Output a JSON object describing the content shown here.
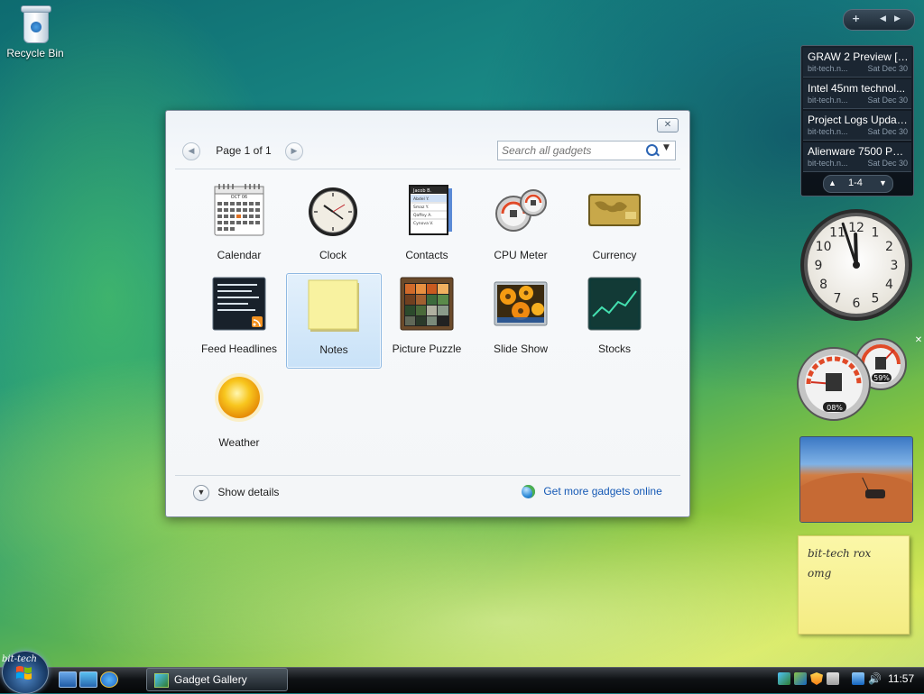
{
  "desktop": {
    "recycle_bin_label": "Recycle Bin"
  },
  "gallery": {
    "page_label": "Page 1 of 1",
    "search_placeholder": "Search all gadgets",
    "gadgets": [
      {
        "name": "Calendar",
        "icon": "calendar-icon"
      },
      {
        "name": "Clock",
        "icon": "clock-icon"
      },
      {
        "name": "Contacts",
        "icon": "contacts-icon"
      },
      {
        "name": "CPU Meter",
        "icon": "cpu-meter-icon"
      },
      {
        "name": "Currency",
        "icon": "currency-icon"
      },
      {
        "name": "Feed Headlines",
        "icon": "feed-headlines-icon"
      },
      {
        "name": "Notes",
        "icon": "notes-icon",
        "selected": true
      },
      {
        "name": "Picture Puzzle",
        "icon": "picture-puzzle-icon"
      },
      {
        "name": "Slide Show",
        "icon": "slide-show-icon"
      },
      {
        "name": "Stocks",
        "icon": "stocks-icon"
      },
      {
        "name": "Weather",
        "icon": "weather-icon"
      }
    ],
    "calendar_thumb_month": "OCT 06",
    "contacts_thumb": {
      "title": "Jacob B.",
      "names": [
        "Abdel Y.",
        "Smaz Y.",
        "Qaffey A.",
        "Cynova V."
      ]
    },
    "show_details_label": "Show details",
    "get_more_label": "Get more gadgets online"
  },
  "sidebar": {
    "feed": {
      "items": [
        {
          "title": "GRAW 2 Preview [G...",
          "source": "bit-tech.n...",
          "date": "Sat Dec 30"
        },
        {
          "title": "Intel 45nm technol...",
          "source": "bit-tech.n...",
          "date": "Sat Dec 30"
        },
        {
          "title": "Project Logs Updat...",
          "source": "bit-tech.n...",
          "date": "Sat Dec 30"
        },
        {
          "title": "Alienware 7500 P2 ...",
          "source": "bit-tech.n...",
          "date": "Sat Dec 30"
        }
      ],
      "range": "1-4"
    },
    "clock": {
      "hour": 11,
      "minute": 57,
      "numerals": [
        "12",
        "1",
        "2",
        "3",
        "4",
        "5",
        "6",
        "7",
        "8",
        "9",
        "10",
        "11"
      ]
    },
    "cpu_meter": {
      "cpu_percent": "08%",
      "memory_percent": "59%"
    },
    "note_lines": [
      "bit-tech rox",
      "omg"
    ]
  },
  "taskbar": {
    "brand_watermark": "bit-tech",
    "active_window": "Gadget Gallery",
    "time": "11:57"
  }
}
